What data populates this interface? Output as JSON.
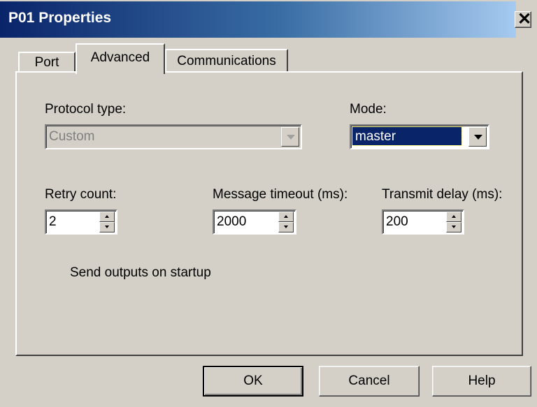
{
  "window": {
    "title": "P01 Properties",
    "close_glyph": "✕"
  },
  "tabs": [
    {
      "label": "Port",
      "selected": false
    },
    {
      "label": "Advanced",
      "selected": true
    },
    {
      "label": "Communications",
      "selected": false
    }
  ],
  "protocol": {
    "label": "Protocol type:",
    "value": "Custom",
    "enabled": false
  },
  "mode": {
    "label": "Mode:",
    "value": "master"
  },
  "retry": {
    "label": "Retry count:",
    "value": "2"
  },
  "timeout": {
    "label": "Message timeout (ms):",
    "value": "2000"
  },
  "delay": {
    "label": "Transmit delay (ms):",
    "value": "200"
  },
  "send_outputs": {
    "label": "Send outputs on startup",
    "checked": false
  },
  "buttons": {
    "ok": "OK",
    "cancel": "Cancel",
    "help": "Help"
  },
  "colors": {
    "dialog_bg": "#d4d0c8",
    "title_start": "#0a246a",
    "title_end": "#a6caf0",
    "selection": "#0a246a"
  }
}
